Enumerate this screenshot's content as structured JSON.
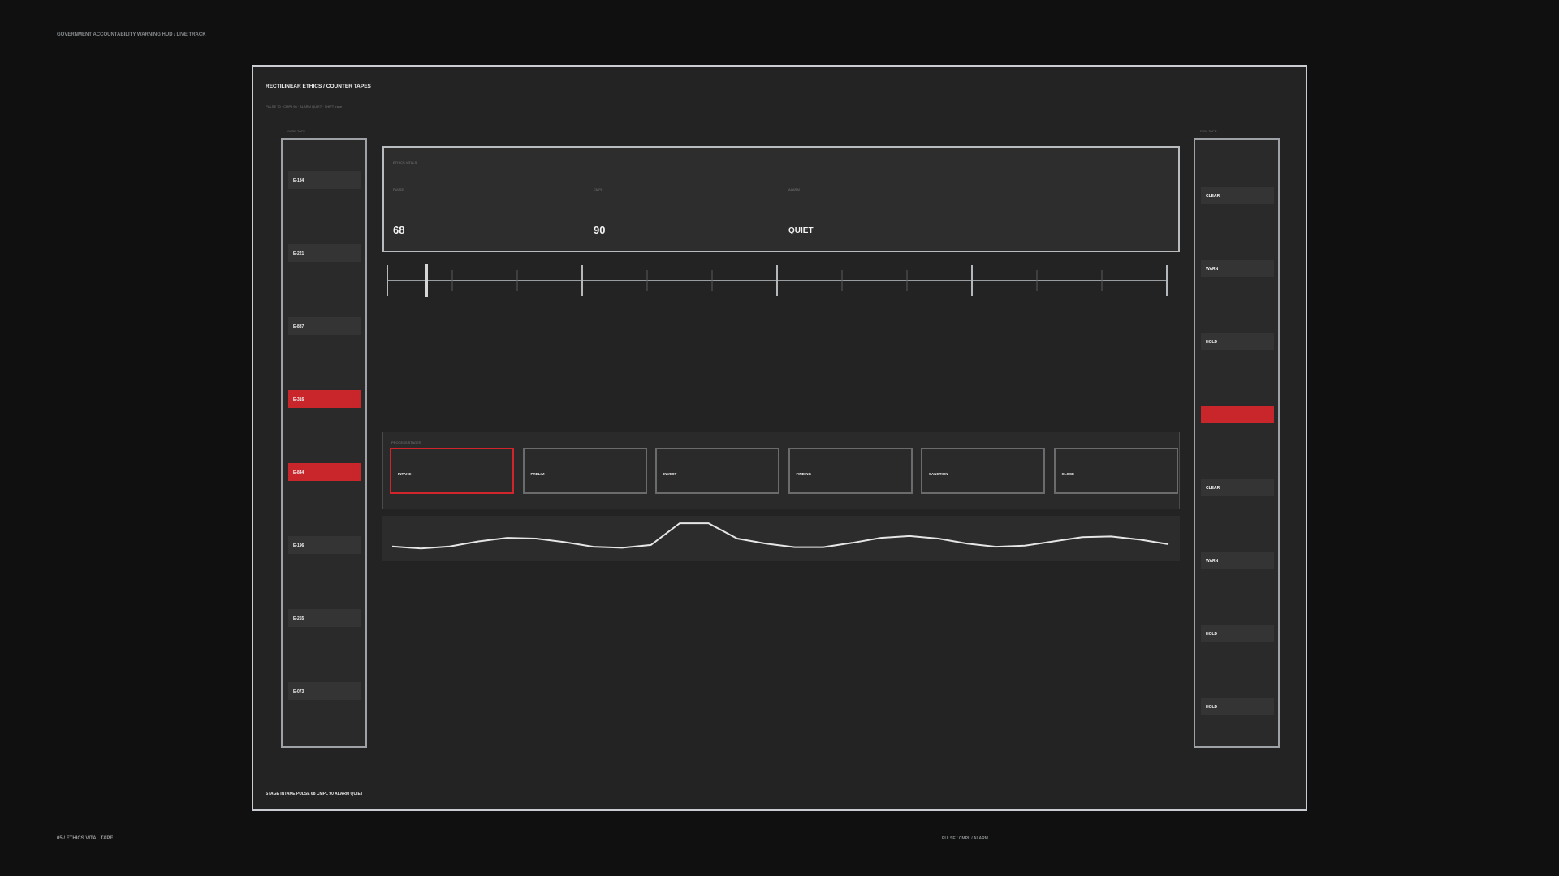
{
  "hud": {
    "title": "GOVERNMENT ACCOUNTABILITY WARNING HUD  /  LIVE TRACK",
    "footer_left": "05 / ETHICS VITAL TAPE",
    "footer_right": "PULSE / CMPL / ALARM"
  },
  "panel": {
    "title": "RECTILINEAR ETHICS  /  COUNTER TAPES",
    "subtitle": "PULSE 70 · CMPL 96 · ALARM QUIET · SHIFT trace",
    "status_line": "STAGE INTAKE   PULSE 68   CMPL 90   ALARM QUIET"
  },
  "case_tape": {
    "label": "CASE TAPE",
    "items": [
      {
        "label": "E-184",
        "alert": false
      },
      {
        "label": "E-221",
        "alert": false
      },
      {
        "label": "E-887",
        "alert": false
      },
      {
        "label": "E-316",
        "alert": true
      },
      {
        "label": "E-844",
        "alert": true
      },
      {
        "label": "E-196",
        "alert": false
      },
      {
        "label": "E-255",
        "alert": false
      },
      {
        "label": "E-073",
        "alert": false
      }
    ]
  },
  "risk_tape": {
    "label": "RISK TAPE",
    "items": [
      {
        "label": "CLEAR",
        "alert": false
      },
      {
        "label": "WARN",
        "alert": false
      },
      {
        "label": "HOLD",
        "alert": false
      },
      {
        "label": "",
        "alert": true
      },
      {
        "label": "CLEAR",
        "alert": false
      },
      {
        "label": "WARN",
        "alert": false
      },
      {
        "label": "HOLD",
        "alert": false
      },
      {
        "label": "HOLD",
        "alert": false
      }
    ]
  },
  "vitals": {
    "label": "ETHICS VITALS",
    "pulse": {
      "label": "PULSE",
      "value": "68"
    },
    "cmpl": {
      "label": "CMPL",
      "value": "90"
    },
    "alarm": {
      "label": "ALARM",
      "value": "QUIET"
    }
  },
  "timeline": {
    "marker_fraction": 0.05
  },
  "stages": {
    "label": "PROCESS STAGES",
    "items": [
      {
        "label": "INTAKE",
        "active": true
      },
      {
        "label": "PRELIM",
        "active": false
      },
      {
        "label": "INVEST",
        "active": false
      },
      {
        "label": "FINDING",
        "active": false
      },
      {
        "label": "SANCTION",
        "active": false
      },
      {
        "label": "CLOSE",
        "active": false
      }
    ]
  },
  "pulse_trace": {
    "values": [
      0.28,
      0.22,
      0.28,
      0.42,
      0.52,
      0.5,
      0.4,
      0.27,
      0.24,
      0.32,
      0.93,
      0.93,
      0.5,
      0.36,
      0.26,
      0.26,
      0.38,
      0.52,
      0.57,
      0.5,
      0.36,
      0.27,
      0.3,
      0.42,
      0.54,
      0.56,
      0.47,
      0.34
    ]
  },
  "colors": {
    "alert": "#c8262b",
    "frame": "#c9ccd0",
    "trace": "#e6e6e6"
  }
}
